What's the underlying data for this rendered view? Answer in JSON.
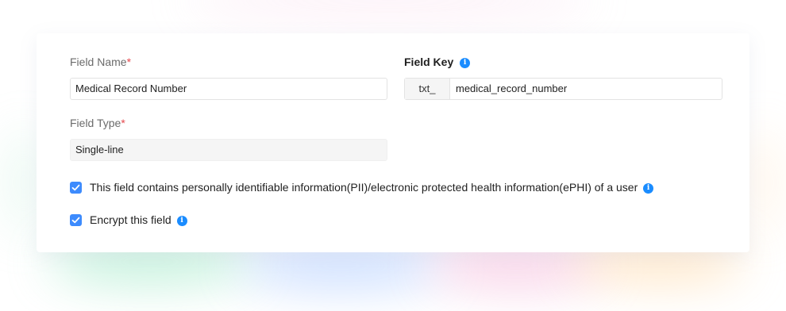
{
  "form": {
    "field_name_label": "Field Name",
    "required_mark": "*",
    "field_name_value": "Medical Record Number",
    "field_key_label": "Field Key",
    "field_key_prefix": "txt_",
    "field_key_value": "medical_record_number",
    "field_type_label": "Field Type",
    "field_type_value": "Single-line"
  },
  "options": {
    "pii_label": "This field contains personally identifiable information(PII)/electronic protected health information(ePHI) of a user",
    "pii_checked": true,
    "encrypt_label": "Encrypt this field",
    "encrypt_checked": true
  },
  "icons": {
    "info": "info-icon",
    "check": "check-icon"
  },
  "colors": {
    "accent": "#3d8bfd",
    "info": "#1a8cff",
    "required": "#e5484d"
  }
}
